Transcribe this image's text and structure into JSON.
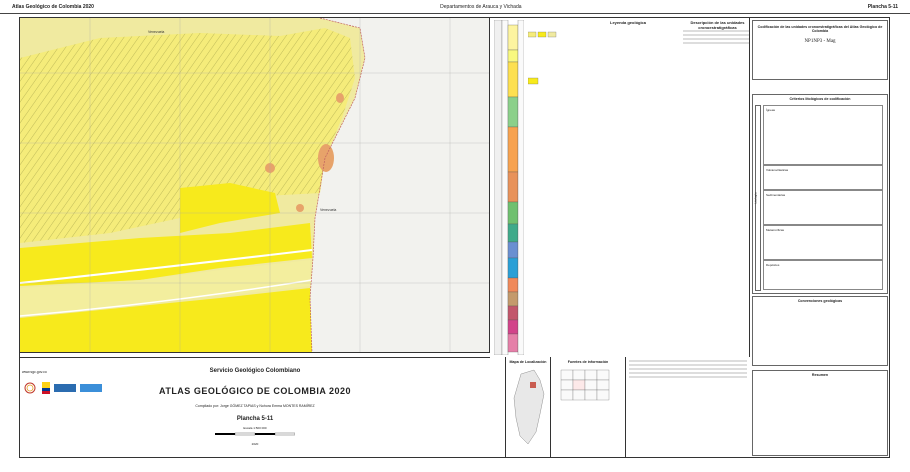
{
  "header": {
    "left": "Atlas Geológico de Colombia 2020",
    "center": "Departamentos de Arauca y Vichada",
    "right": "Plancha 5-11"
  },
  "map": {
    "labels": [
      "Venezuela",
      "Venezuela"
    ],
    "colors": {
      "yellow": "#f7ea1c",
      "pale_yellow": "#f5ec7a",
      "light_yellow": "#f0eaa0",
      "orange_blob": "#e7a36a",
      "background": "#f2f2ee"
    }
  },
  "legend": {
    "title": "Leyenda geológica",
    "desc_title": "Descripción de las unidades cronoestratigráficas"
  },
  "right_panel": {
    "box1_title": "Codificación de las unidades cronoestratigráficas del Atlas Geológico de Colombia",
    "code_example": "NP1NP3 - Mag",
    "box2_title": "Criterios litológicos de codificación",
    "lith_groups": [
      "Ígneas",
      "Volcanoclásticas",
      "Sedimentarias",
      "Metamórficas",
      "Depósitos"
    ],
    "side_label": "Litología",
    "box3_title": "Convenciones geológicas",
    "box4_title": "Resumen"
  },
  "bottom": {
    "org": "Servicio Geológico Colombiano",
    "atlas": "ATLAS GEOLÓGICO DE COLOMBIA 2020",
    "compiled": "Compilado por: Jorge GÓMEZ TAPIAS y Nohora Emma MONTES RAMÍREZ",
    "plancha": "Plancha 5-11",
    "scale": "Escala 1:500 000",
    "year": "2020",
    "website": "www.sgc.gov.co",
    "map_loc_title": "Mapa de Localización",
    "sources_title": "Fuentes de información"
  }
}
